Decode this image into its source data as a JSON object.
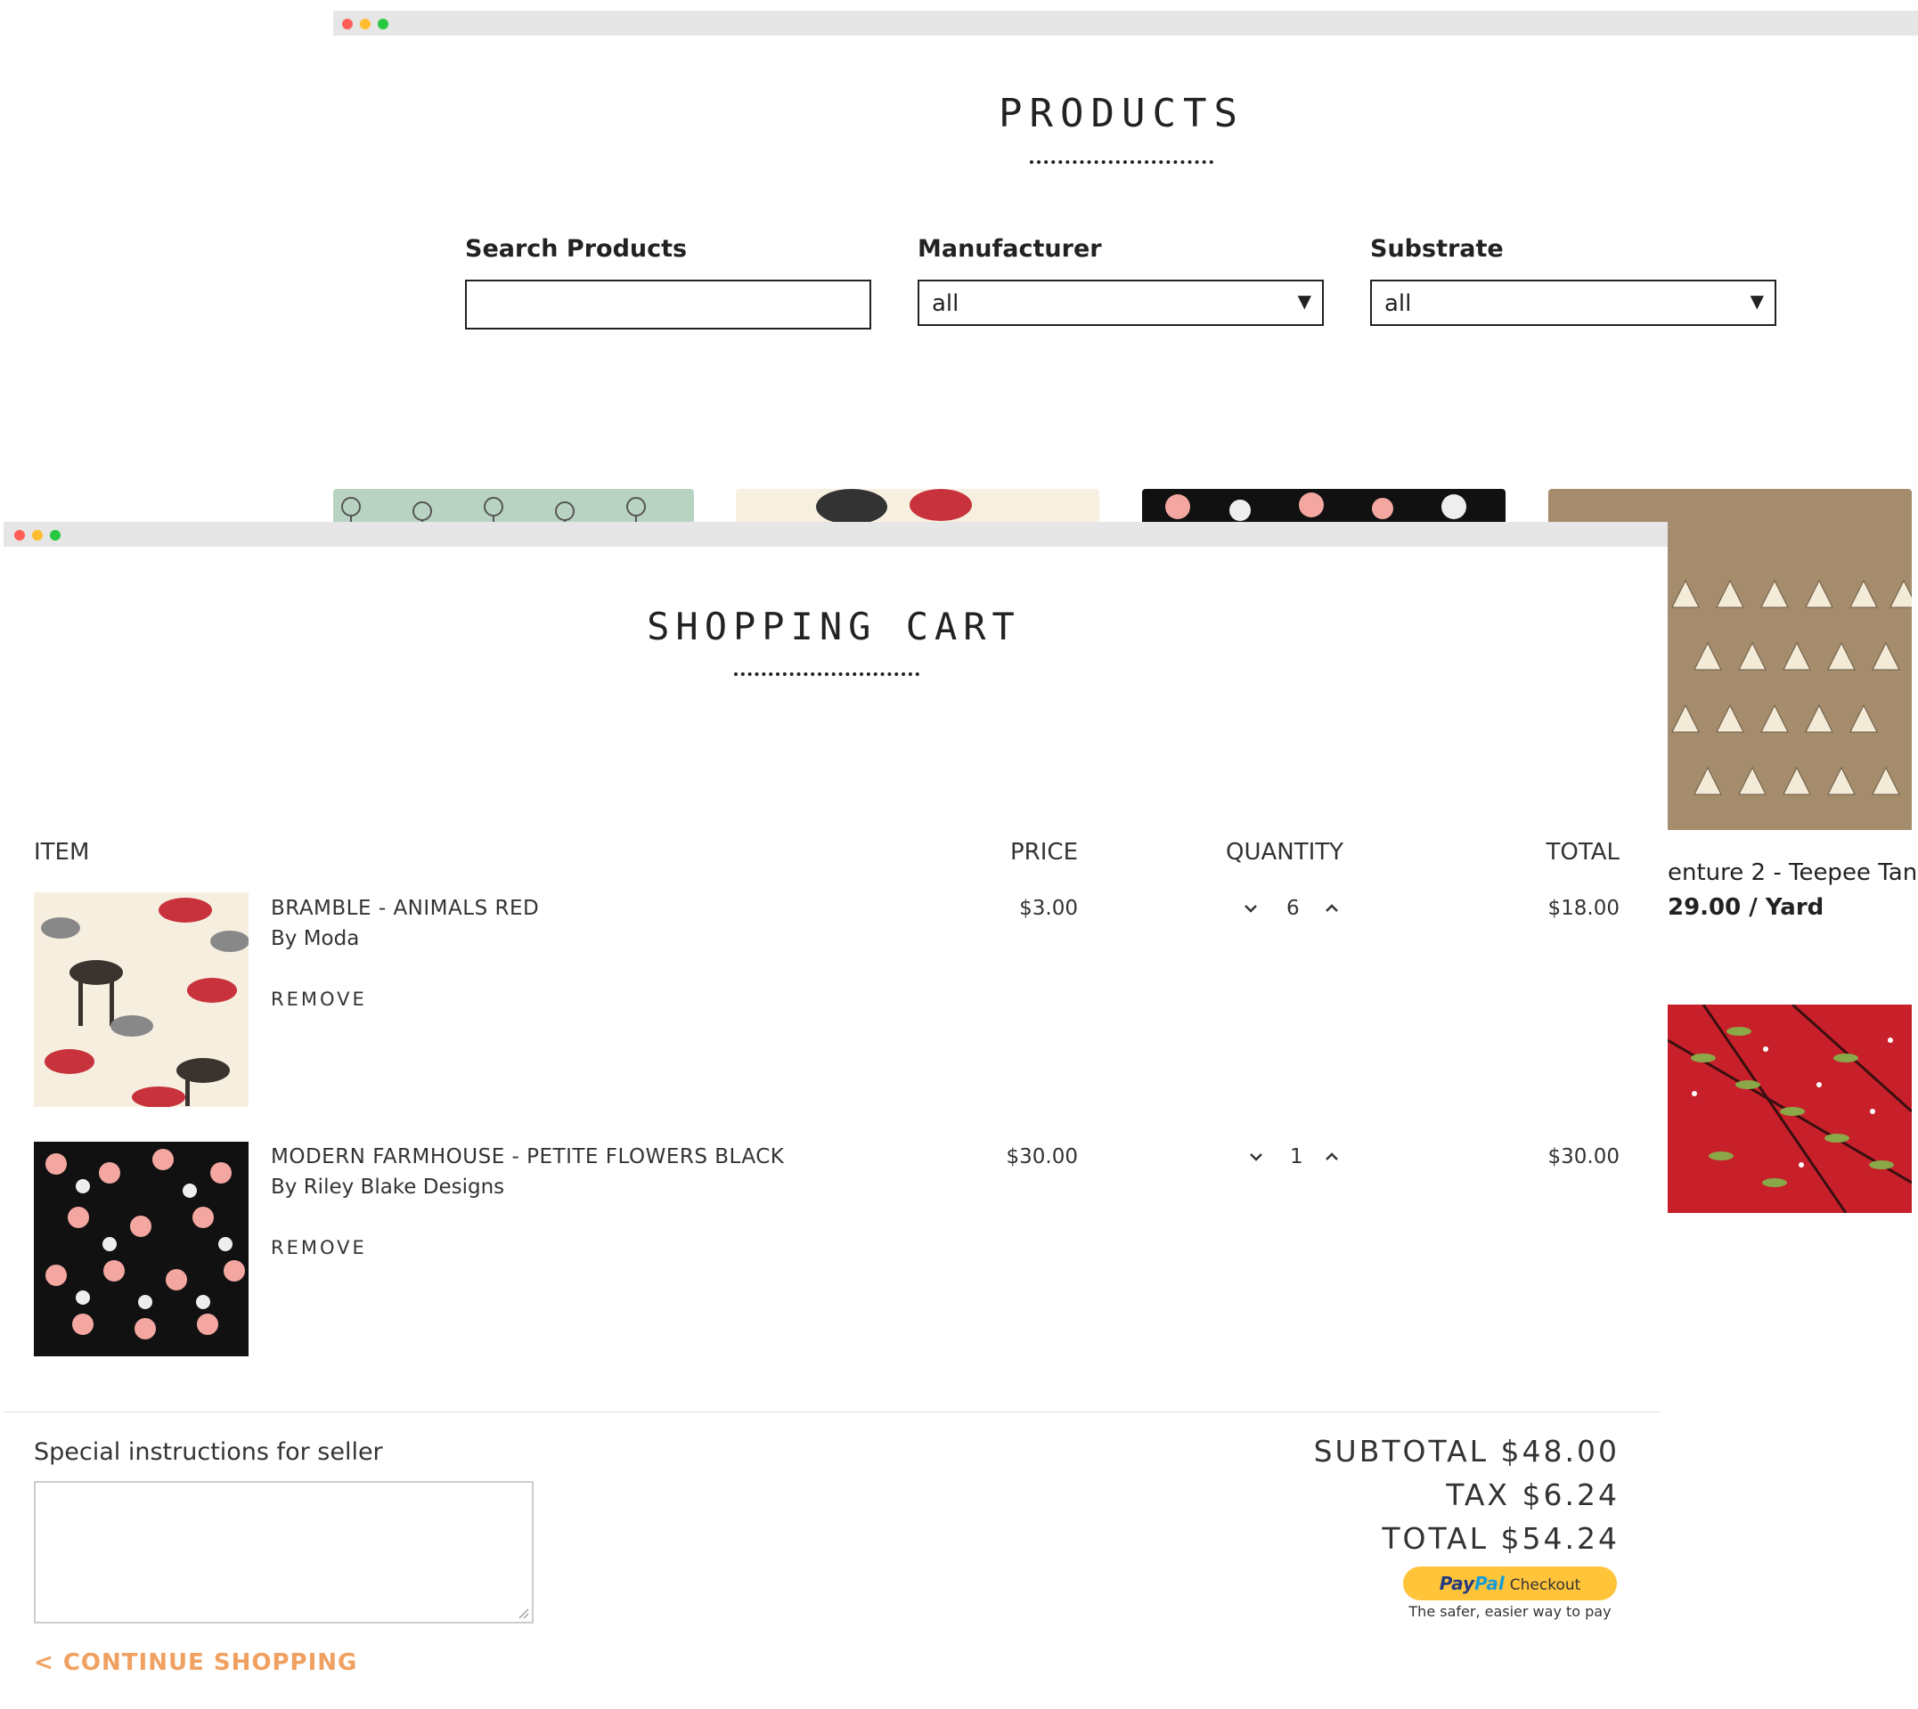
{
  "products_page": {
    "title": "PRODUCTS",
    "search_label": "Search Products",
    "search_value": "",
    "manufacturer_label": "Manufacturer",
    "manufacturer_value": "all",
    "substrate_label": "Substrate",
    "substrate_value": "all",
    "side_product_name": "enture 2 - Teepee Tan",
    "side_product_price": "29.00 / Yard"
  },
  "cart": {
    "title": "SHOPPING CART",
    "headers": {
      "item": "ITEM",
      "price": "PRICE",
      "quantity": "QUANTITY",
      "total": "TOTAL"
    },
    "items": [
      {
        "name": "BRAMBLE - ANIMALS RED",
        "by": "By Moda",
        "price": "$3.00",
        "qty": "6",
        "total": "$18.00",
        "remove": "REMOVE"
      },
      {
        "name": "MODERN FARMHOUSE - PETITE FLOWERS BLACK",
        "by": "By Riley Blake Designs",
        "price": "$30.00",
        "qty": "1",
        "total": "$30.00",
        "remove": "REMOVE"
      }
    ],
    "instructions_label": "Special instructions for seller",
    "instructions_value": "",
    "subtotal": "SUBTOTAL $48.00",
    "tax": "TAX $6.24",
    "total": "TOTAL $54.24",
    "paypal": {
      "pay": "Pay",
      "pal": "Pal",
      "checkout": "Checkout",
      "tagline": "The safer, easier way to pay"
    },
    "continue": "< CONTINUE SHOPPING"
  },
  "colors": {
    "accent": "#f0a060",
    "paypal": "#ffc439",
    "titlebar": "#e6e6e6"
  }
}
